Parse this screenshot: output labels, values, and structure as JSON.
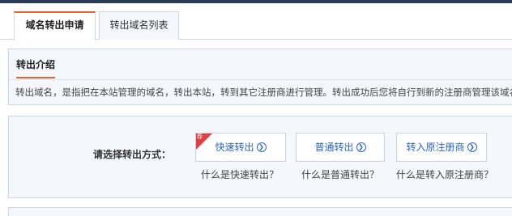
{
  "tabs": [
    {
      "label": "域名转出申请",
      "active": true
    },
    {
      "label": "转出域名列表",
      "active": false
    }
  ],
  "intro": {
    "title": "转出介绍",
    "text": "转出域名，是指把在本站管理的域名，转出本站，转到其它注册商进行管理。转出成功后您将自行到新的注册商管理该域名"
  },
  "method": {
    "label": "请选择转出方式：",
    "options": [
      {
        "label": "快速转出",
        "help": "什么是快速转出？",
        "badge": "荐"
      },
      {
        "label": "普通转出",
        "help": "什么是普通转出？"
      },
      {
        "label": "转入原注册商",
        "help": "什么是转入原注册商？"
      }
    ]
  },
  "icons": {
    "arrow": "arrow-circle-right-icon",
    "arrow_glyph": "❯"
  },
  "colors": {
    "accent": "#e8632b",
    "link": "#2a66c8",
    "badge": "#e04040",
    "panel_bg": "#f4f7fb",
    "border": "#cdd6e4",
    "topbar": "#2b3a55"
  }
}
